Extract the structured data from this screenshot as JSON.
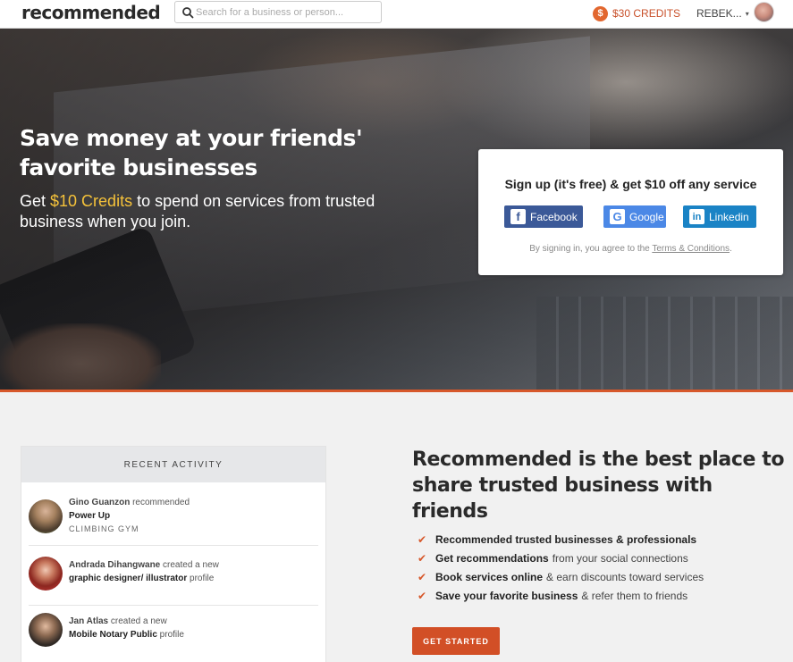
{
  "navbar": {
    "logo": "recommended",
    "search_placeholder": "Search for a business or person...",
    "credits_badge": "$",
    "credits_label": "$30 CREDITS",
    "user_name": "REBEK...",
    "caret": "▾"
  },
  "hero": {
    "title": "Save money at your friends' favorite businesses",
    "sub_prefix": "Get ",
    "sub_highlight": "$10 Credits",
    "sub_suffix": " to spend on services from trusted business when you join.",
    "highlight_color": "#f5c23a"
  },
  "signup": {
    "title": "Sign up (it's free) & get $10 off any service",
    "facebook_label": "Facebook",
    "google_label": "Google",
    "linkedin_label": "Linkedin",
    "terms_prefix": "By signing in, you agree to the ",
    "terms_link": "Terms & Conditions",
    "terms_suffix": "."
  },
  "activity": {
    "header": "RECENT ACTIVITY",
    "items": [
      {
        "actor": "Gino Guanzon",
        "action": " recommended",
        "target": "Power Up",
        "target_suffix": "",
        "category": "CLIMBING GYM"
      },
      {
        "actor": "Andrada Dihangwane",
        "action": " created a new",
        "target": "graphic designer/ illustrator",
        "target_suffix": " profile",
        "category": ""
      },
      {
        "actor": "Jan Atlas",
        "action": " created a new",
        "target": "Mobile Notary Public",
        "target_suffix": " profile",
        "category": ""
      }
    ]
  },
  "value": {
    "title": "Recommended is the best place to share trusted business with friends",
    "features": [
      {
        "bold": "Recommended trusted businesses & professionals",
        "rest": ""
      },
      {
        "bold": "Get recommendations",
        "rest": "from your social connections"
      },
      {
        "bold": "Book services online",
        "rest": "& earn discounts toward services"
      },
      {
        "bold": "Save your favorite business",
        "rest": "& refer them to friends"
      }
    ],
    "cta_label": "GET STARTED"
  },
  "colors": {
    "accent": "#d7582b",
    "facebook": "#3b5998",
    "google": "#4b88e6",
    "linkedin": "#1a83c5"
  }
}
